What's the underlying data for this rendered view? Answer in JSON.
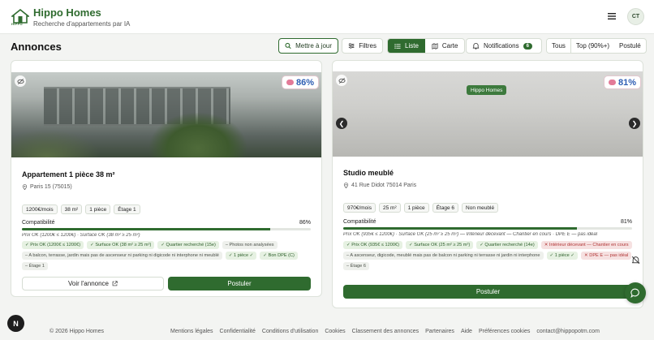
{
  "header": {
    "logo_text": "HIPPO",
    "brand": "Hippo Homes",
    "tagline": "Recherche d'appartements par IA",
    "avatar": "CT"
  },
  "page": {
    "title": "Annonces"
  },
  "toolbar": {
    "refresh_label": "Mettre à jour",
    "filters_label": "Filtres",
    "view_list": "Liste",
    "view_map": "Carte",
    "active_view": "Liste",
    "notifications_label": "Notifications",
    "notifications_count": "6",
    "filter_all": "Tous",
    "filter_top": "Top (90%+)",
    "filter_applied": "Postulé",
    "selected_filter": "Tous"
  },
  "listings": [
    {
      "score": "86%",
      "title": "Appartement 1 pièce 38 m²",
      "address": "Paris 15 (75015)",
      "chips": [
        "1200€/mois",
        "38 m²",
        "1 pièce",
        "Étage 1"
      ],
      "compat_label": "Compatibilité",
      "compat_pct": "86%",
      "compat_value": 86,
      "detail": "Prix OK (1200€ ≤ 1200€) · Surface OK (38 m² ≥ 25 m²)",
      "tags": [
        {
          "text": "✓ Prix OK (1200€ ≤ 1200€)",
          "kind": "ok"
        },
        {
          "text": "✓ Surface OK (38 m² ≥ 25 m²)",
          "kind": "ok"
        },
        {
          "text": "✓ Quartier recherché (15e)",
          "kind": "ok"
        },
        {
          "text": "– Photos non analysées",
          "kind": "neutral"
        },
        {
          "text": "– A balcon, terrasse, jardin mais pas de ascenseur ni parking ni digicode ni interphone ni meublé",
          "kind": "neutral"
        },
        {
          "text": "✓ 1 pièce ✓",
          "kind": "ok"
        },
        {
          "text": "✓ Bon DPE (C)",
          "kind": "ok"
        },
        {
          "text": "– Étage 1",
          "kind": "neutral"
        }
      ],
      "view_label": "Voir l'annonce",
      "apply_label": "Postuler"
    },
    {
      "score": "81%",
      "source_badge": "Hippo Homes",
      "title": "Studio meublé",
      "address": "41 Rue Didot 75014 Paris",
      "chips": [
        "970€/mois",
        "25 m²",
        "1 pièce",
        "Étage 6",
        "Non meublé"
      ],
      "compat_label": "Compatibilité",
      "compat_pct": "81%",
      "compat_value": 81,
      "detail": "Prix OK (935€ ≤ 1200€) · Surface OK (25 m² ≥ 25 m²) — Intérieur décevant — Chantier en cours · DPE E — pas idéal",
      "tags": [
        {
          "text": "✓ Prix OK (935€ ≤ 1200€)",
          "kind": "ok"
        },
        {
          "text": "✓ Surface OK (25 m² ≥ 25 m²)",
          "kind": "ok"
        },
        {
          "text": "✓ Quartier recherché (14e)",
          "kind": "ok"
        },
        {
          "text": "✕ Intérieur décevant — Chantier en cours",
          "kind": "bad"
        },
        {
          "text": "– A ascenseur, digicode, meublé mais pas de balcon ni parking ni terrasse ni jardin ni interphone",
          "kind": "neutral"
        },
        {
          "text": "✓ 1 pièce ✓",
          "kind": "ok"
        },
        {
          "text": "✕ DPE E — pas idéal",
          "kind": "bad"
        },
        {
          "text": "– Étage 6",
          "kind": "neutral"
        }
      ],
      "apply_label": "Postuler"
    }
  ],
  "floating": {
    "n_badge": "N"
  },
  "footer": {
    "copyright": "© 2026 Hippo Homes",
    "links": [
      "Mentions légales",
      "Confidentialité",
      "Conditions d'utilisation",
      "Cookies",
      "Classement des annonces",
      "Partenaires",
      "Aide",
      "Préférences cookies",
      "contact@hippopotm.com"
    ]
  },
  "colors": {
    "brand": "#2f6b2f",
    "score": "#2d5db3",
    "bad": "#b03434"
  }
}
